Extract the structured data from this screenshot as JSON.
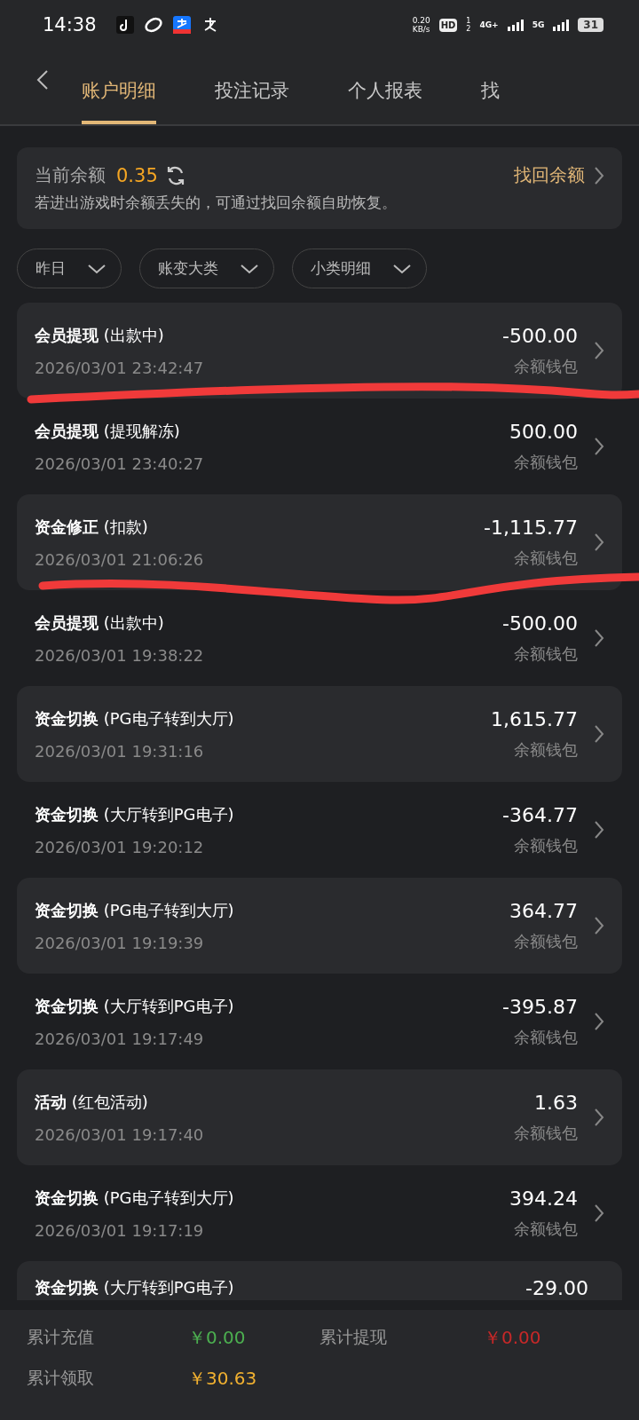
{
  "status_bar": {
    "time": "14:38",
    "net_speed_value": "0.20",
    "net_speed_unit": "KB/s",
    "hd": "HD",
    "sim_1": "1",
    "sim_2": "2",
    "network_1": "4G+",
    "network_2": "5G",
    "battery": "31"
  },
  "tabs": [
    {
      "label": "账户明细",
      "selected": true
    },
    {
      "label": "投注记录",
      "selected": false
    },
    {
      "label": "个人报表",
      "selected": false
    },
    {
      "label": "找",
      "selected": false
    }
  ],
  "balance_card": {
    "label": "当前余额",
    "amount": "0.35",
    "recover_link": "找回余额",
    "note": "若进出游戏时余额丢失的，可通过找回余额自助恢复。"
  },
  "filters": [
    {
      "label": "昨日"
    },
    {
      "label": "账变大类"
    },
    {
      "label": "小类明细"
    }
  ],
  "records": [
    {
      "title": "**会员提现** (出款中)",
      "time": "2026/03/01 23:42:47",
      "amount": "-500.00",
      "wallet": "余额钱包"
    },
    {
      "title": "**会员提现** (提现解冻)",
      "time": "2026/03/01 23:40:27",
      "amount": "500.00",
      "wallet": "余额钱包"
    },
    {
      "title": "**资金修正** (扣款)",
      "time": "2026/03/01 21:06:26",
      "amount": "-1,115.77",
      "wallet": "余额钱包"
    },
    {
      "title": "**会员提现** (出款中)",
      "time": "2026/03/01 19:38:22",
      "amount": "-500.00",
      "wallet": "余额钱包"
    },
    {
      "title": "**资金切换** (PG电子转到大厅)",
      "time": "2026/03/01 19:31:16",
      "amount": "1,615.77",
      "wallet": "余额钱包"
    },
    {
      "title": "**资金切换** (大厅转到PG电子)",
      "time": "2026/03/01 19:20:12",
      "amount": "-364.77",
      "wallet": "余额钱包"
    },
    {
      "title": "**资金切换** (PG电子转到大厅)",
      "time": "2026/03/01 19:19:39",
      "amount": "364.77",
      "wallet": "余额钱包"
    },
    {
      "title": "**资金切换** (大厅转到PG电子)",
      "time": "2026/03/01 19:17:49",
      "amount": "-395.87",
      "wallet": "余额钱包"
    },
    {
      "title": "**活动** (红包活动)",
      "time": "2026/03/01 19:17:40",
      "amount": "1.63",
      "wallet": "余额钱包"
    },
    {
      "title": "**资金切换** (PG电子转到大厅)",
      "time": "2026/03/01 19:17:19",
      "amount": "394.24",
      "wallet": "余额钱包"
    },
    {
      "title": "**资金切换** (大厅转到PG电子)",
      "amount": "-29.00"
    }
  ],
  "summary": [
    {
      "label": "累计充值",
      "value": "￥0.00",
      "color": "#4caf50"
    },
    {
      "label": "累计提现",
      "value": "￥0.00",
      "color": "#c62828"
    },
    {
      "label": "累计领取",
      "value": "￥30.63",
      "color": "#f0b030"
    }
  ],
  "markup": [
    {
      "kind": "stroke"
    },
    {
      "kind": "stroke"
    }
  ]
}
